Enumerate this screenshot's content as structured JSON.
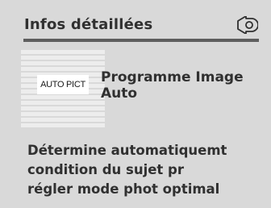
{
  "header": {
    "title": "Infos détaillées",
    "back_icon": "back-return-icon"
  },
  "mode": {
    "badge": "AUTO PICT",
    "name_line1": "Programme Image",
    "name_line2": "Auto"
  },
  "description": {
    "line1": "Détermine automatiquemt",
    "line2": "condition du sujet pr",
    "line3": "régler mode phot optimal"
  },
  "colors": {
    "background": "#d9d9d9",
    "text": "#303030",
    "rule": "#5e5e5e",
    "badge_bg": "#ffffff"
  }
}
